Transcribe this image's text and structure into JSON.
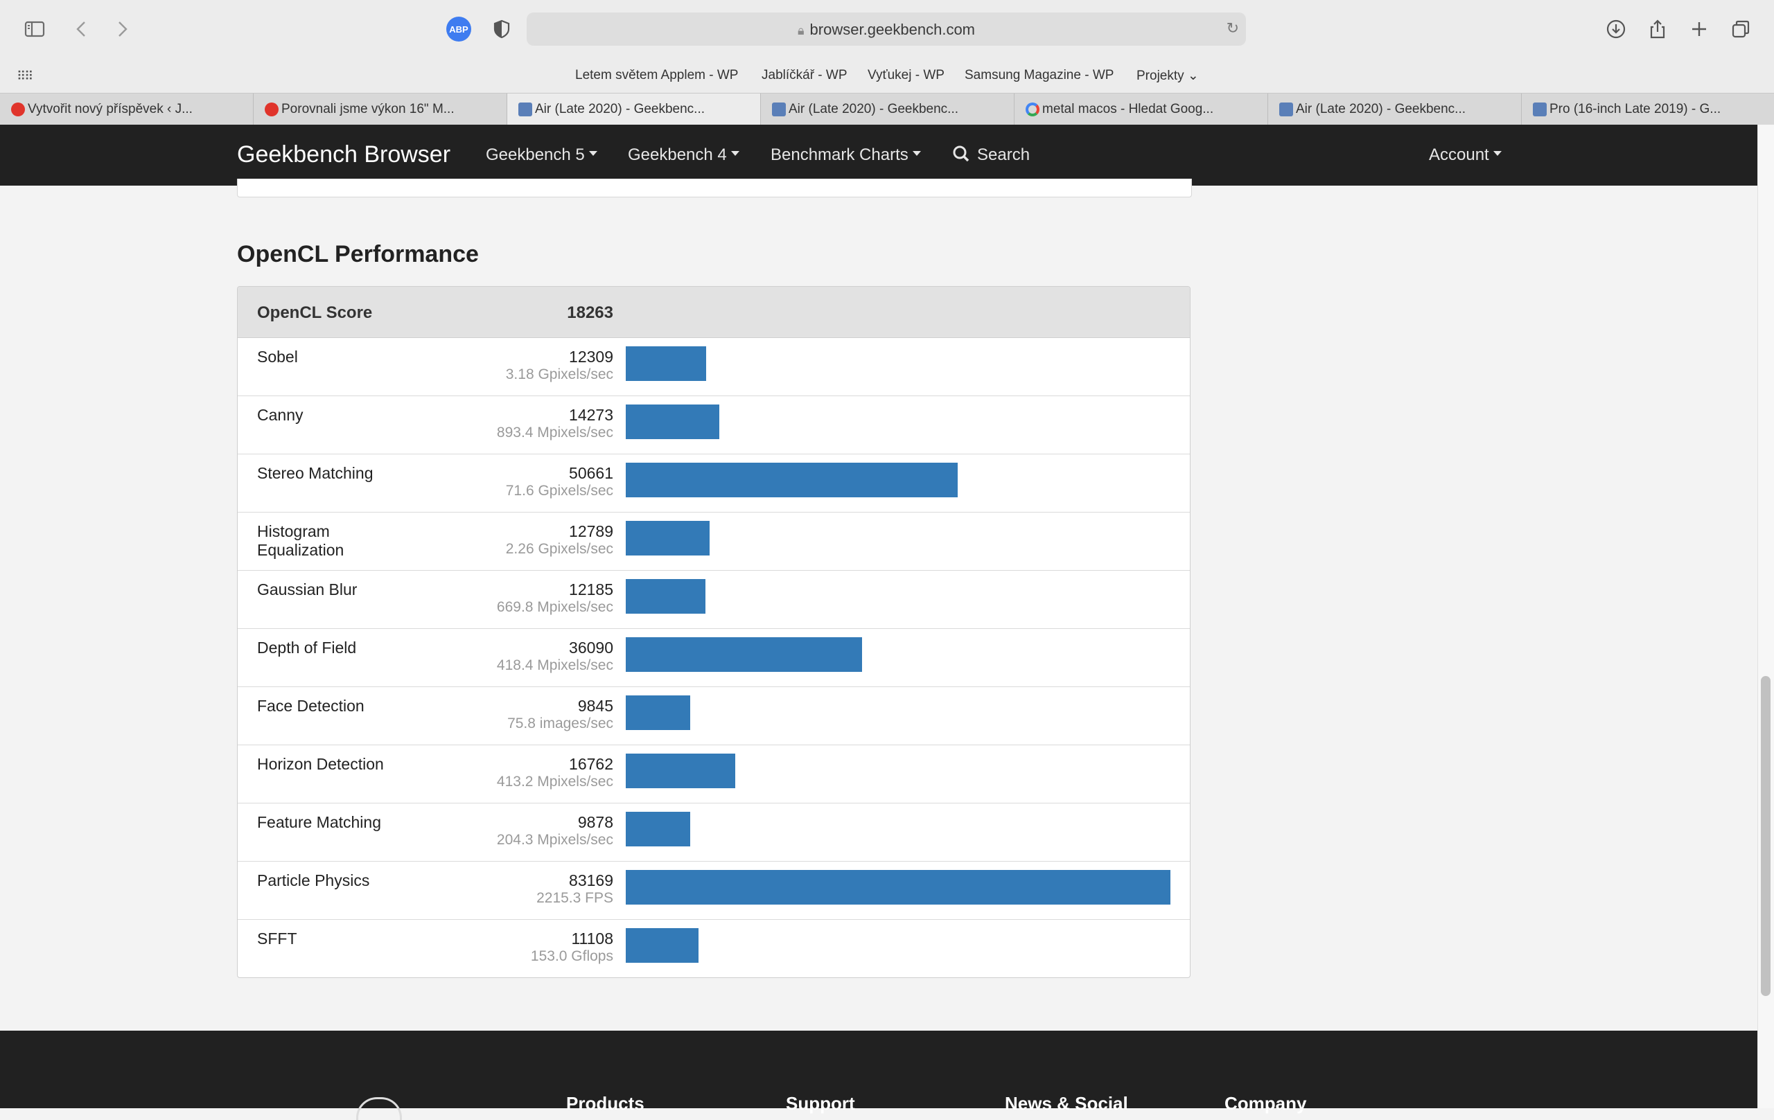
{
  "browser": {
    "url": "browser.geekbench.com",
    "abp_label": "ABP",
    "bookmarks": [
      {
        "label": "Letem světem Applem - WP"
      },
      {
        "label": "Jablíčkář - WP"
      },
      {
        "label": "Vyťukej - WP"
      },
      {
        "label": "Samsung Magazine - WP"
      },
      {
        "label": "Projekty ⌄"
      }
    ],
    "tabs": [
      {
        "label": "Vytvořit nový příspěvek ‹ J...",
        "favicon": "red-drop"
      },
      {
        "label": "Porovnali jsme výkon 16\" M...",
        "favicon": "red-drop"
      },
      {
        "label": "Air (Late 2020) - Geekbenc...",
        "favicon": "geekbench"
      },
      {
        "label": "Air (Late 2020) - Geekbenc...",
        "favicon": "geekbench"
      },
      {
        "label": "metal macos - Hledat Goog...",
        "favicon": "google"
      },
      {
        "label": "Air (Late 2020) - Geekbenc...",
        "favicon": "geekbench"
      },
      {
        "label": "Pro (16-inch Late 2019) - G...",
        "favicon": "geekbench"
      }
    ],
    "active_tab": 2
  },
  "nav": {
    "brand": "Geekbench Browser",
    "items": [
      {
        "label": "Geekbench 5"
      },
      {
        "label": "Geekbench 4"
      },
      {
        "label": "Benchmark Charts"
      }
    ],
    "search": "Search",
    "account": "Account"
  },
  "section": {
    "title": "OpenCL Performance",
    "score_label": "OpenCL Score",
    "score_value": "18263"
  },
  "chart_data": {
    "type": "bar",
    "orientation": "horizontal",
    "bar_color": "#337ab7",
    "max": 83169,
    "rows": [
      {
        "name": "Sobel",
        "score": 12309,
        "score_text": "12309",
        "sub": "3.18 Gpixels/sec"
      },
      {
        "name": "Canny",
        "score": 14273,
        "score_text": "14273",
        "sub": "893.4 Mpixels/sec"
      },
      {
        "name": "Stereo Matching",
        "score": 50661,
        "score_text": "50661",
        "sub": "71.6 Gpixels/sec"
      },
      {
        "name": "Histogram Equalization",
        "score": 12789,
        "score_text": "12789",
        "sub": "2.26 Gpixels/sec"
      },
      {
        "name": "Gaussian Blur",
        "score": 12185,
        "score_text": "12185",
        "sub": "669.8 Mpixels/sec"
      },
      {
        "name": "Depth of Field",
        "score": 36090,
        "score_text": "36090",
        "sub": "418.4 Mpixels/sec"
      },
      {
        "name": "Face Detection",
        "score": 9845,
        "score_text": "9845",
        "sub": "75.8 images/sec"
      },
      {
        "name": "Horizon Detection",
        "score": 16762,
        "score_text": "16762",
        "sub": "413.2 Mpixels/sec"
      },
      {
        "name": "Feature Matching",
        "score": 9878,
        "score_text": "9878",
        "sub": "204.3 Mpixels/sec"
      },
      {
        "name": "Particle Physics",
        "score": 83169,
        "score_text": "83169",
        "sub": "2215.3 FPS"
      },
      {
        "name": "SFFT",
        "score": 11108,
        "score_text": "11108",
        "sub": "153.0 Gflops"
      }
    ]
  },
  "footer": {
    "columns": [
      {
        "label": "Products"
      },
      {
        "label": "Support"
      },
      {
        "label": "News & Social"
      },
      {
        "label": "Company"
      }
    ]
  }
}
